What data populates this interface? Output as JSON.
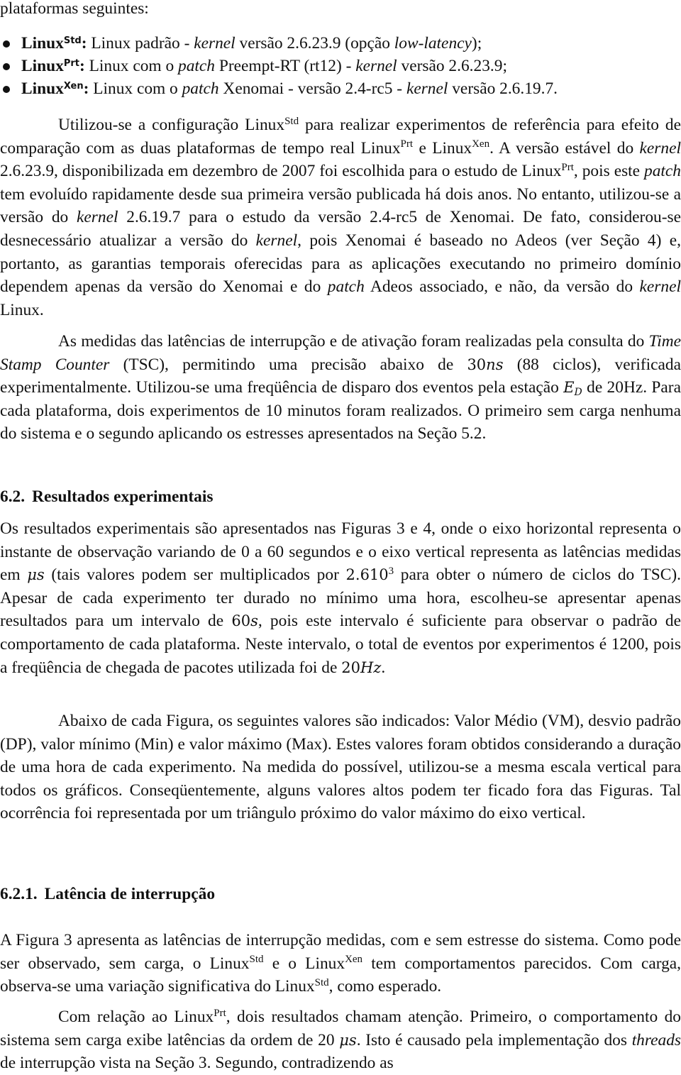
{
  "intro_line": "plataformas seguintes:",
  "platforms": [
    {
      "name": "Linux",
      "sup": "Std",
      "segments": [
        {
          "t": " Linux padrão - "
        },
        {
          "t": "kernel",
          "i": true
        },
        {
          "t": " versão 2.6.23.9 (opção "
        },
        {
          "t": "low-latency",
          "i": true
        },
        {
          "t": ");"
        }
      ]
    },
    {
      "name": "Linux",
      "sup": "Prt",
      "segments": [
        {
          "t": " Linux com o "
        },
        {
          "t": "patch",
          "i": true
        },
        {
          "t": " Preempt-RT (rt12) - "
        },
        {
          "t": "kernel",
          "i": true
        },
        {
          "t": " versão 2.6.23.9;"
        }
      ]
    },
    {
      "name": "Linux",
      "sup": "Xen",
      "segments": [
        {
          "t": " Linux com o "
        },
        {
          "t": "patch",
          "i": true
        },
        {
          "t": " Xenomai - versão 2.4-rc5 - "
        },
        {
          "t": "kernel",
          "i": true
        },
        {
          "t": " versão 2.6.19.7."
        }
      ]
    }
  ],
  "paragraphs": {
    "p1": [
      {
        "t": "Utilizou-se a configuração Linux"
      },
      {
        "sup": "Std"
      },
      {
        "t": " para realizar experimentos de referência para efeito de comparação com as duas plataformas de tempo real Linux"
      },
      {
        "sup": "Prt"
      },
      {
        "t": " e Linux"
      },
      {
        "sup": "Xen"
      },
      {
        "t": ". A ver­são estável do "
      },
      {
        "t": "kernel",
        "i": true
      },
      {
        "t": " 2.6.23.9, disponibilizada em dezembro de 2007 foi escolhida para o estudo de Linux"
      },
      {
        "sup": "Prt"
      },
      {
        "t": ", pois este "
      },
      {
        "t": "patch",
        "i": true
      },
      {
        "t": " tem evoluído rapidamente desde sua primeira versão publicada há dois anos. No entanto, utilizou-se a versão do "
      },
      {
        "t": "kernel",
        "i": true
      },
      {
        "t": " 2.6.19.7 para o estudo da versão 2.4-rc5 de Xenomai. De fato, considerou-se desnecessário atualizar a versão do "
      },
      {
        "t": "kernel",
        "i": true
      },
      {
        "t": ", pois Xenomai é baseado no Adeos (ver Seção 4) e, portanto, as garantias tempo­rais oferecidas para as aplicações executando no primeiro domínio dependem apenas da versão do Xenomai e do "
      },
      {
        "t": "patch",
        "i": true
      },
      {
        "t": " Adeos associado, e não, da versão do "
      },
      {
        "t": "kernel",
        "i": true
      },
      {
        "t": " Linux."
      }
    ],
    "p2": [
      {
        "t": "As medidas das latências de interrupção e de ativação foram realizadas pela con­sulta do "
      },
      {
        "t": "Time Stamp Counter",
        "i": true
      },
      {
        "t": " (TSC), permitindo uma precisão abaixo de "
      },
      {
        "m": "30"
      },
      {
        "mi": "ns"
      },
      {
        "t": " (88 ciclos), verificada experimentalmente. Utilizou-se uma freqüência de disparo dos eventos pela estação "
      },
      {
        "mi": "E",
        "sub": "D"
      },
      {
        "t": " de 20Hz. Para cada plataforma, dois experimentos de 10 minutos foram re­alizados. O primeiro sem carga nenhuma do sistema e o segundo aplicando os estresses apresentados na Seção 5.2."
      }
    ],
    "p3": [
      {
        "t": "Os resultados experimentais são apresentados nas Figuras 3 e 4, onde o eixo horizontal re­presenta o instante de observação variando de 0 a 60 segundos e o eixo vertical representa as latências medidas em "
      },
      {
        "mi": "μs"
      },
      {
        "t": " (tais valores podem ser multiplicados por "
      },
      {
        "m": "2.610"
      },
      {
        "msup": "3"
      },
      {
        "t": " para obter o número de ciclos do TSC). Apesar de cada experimento ter durado no mínimo uma hora, escolheu-se apresentar apenas resultados para um intervalo de "
      },
      {
        "m": "60"
      },
      {
        "mi": "s"
      },
      {
        "t": ", pois este intervalo é suficiente para observar o padrão de comportamento de cada plataforma. Neste inter­valo, o total de eventos por experimentos é 1200, pois a freqüência de chegada de pacotes utilizada foi de "
      },
      {
        "m": "20"
      },
      {
        "mi": "Hz"
      },
      {
        "t": "."
      }
    ],
    "p4": [
      {
        "t": "Abaixo de cada Figura, os seguintes valores são indicados: Valor Médio (VM), desvio padrão (DP), valor mínimo (Min) e valor máximo (Max). Estes valores foram obtidos considerando a duração de uma hora de cada experimento. Na medida do possível, utilizou-se a mesma escala vertical para todos os gráficos. Conseqüentemente, alguns valores altos podem ter ficado fora das Figuras. Tal ocorrência foi representada por um triângulo próximo do valor máximo do eixo vertical."
      }
    ],
    "p5": [
      {
        "t": "A Figura 3 apresenta as latências de interrupção medidas, com e sem estresse do sistema. Como pode ser observado, sem carga, o Linux"
      },
      {
        "sup": "Std"
      },
      {
        "t": " e o Linux"
      },
      {
        "sup": "Xen"
      },
      {
        "t": " tem comportamentos parecidos. Com carga, observa-se uma variação significativa do Linux"
      },
      {
        "sup": "Std"
      },
      {
        "t": ", como esperado."
      }
    ],
    "p6": [
      {
        "t": "Com relação ao Linux"
      },
      {
        "sup": "Prt"
      },
      {
        "t": ", dois resultados chamam atenção. Primeiro, o compor­tamento do sistema sem carga exibe latências da ordem de 20 "
      },
      {
        "mi": "μs"
      },
      {
        "t": ". Isto é causado pela implementação dos "
      },
      {
        "t": "threads",
        "i": true
      },
      {
        "t": " de interrupção vista na Seção 3. Segundo, contradizendo as"
      }
    ]
  },
  "headings": {
    "h62": {
      "number": "6.2.",
      "title": "Resultados experimentais"
    },
    "h621": {
      "number": "6.2.1.",
      "title": "Latência de interrupção"
    }
  }
}
